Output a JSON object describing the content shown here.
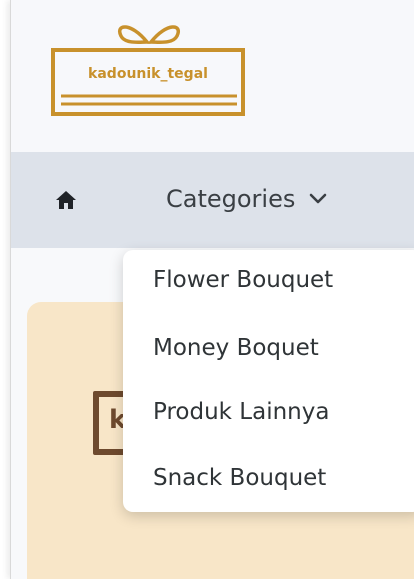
{
  "header": {
    "logo_text": "kadounik_tegal",
    "brand_color": "#c8912c"
  },
  "navbar": {
    "home_icon": "home-icon",
    "categories_label": "Categories",
    "categories_icon": "chevron-down-icon"
  },
  "dropdown": {
    "items": [
      {
        "label": "Flower Bouquet"
      },
      {
        "label": "Money Boquet"
      },
      {
        "label": "Produk Lainnya"
      },
      {
        "label": "Snack Bouquet"
      }
    ]
  },
  "card": {
    "logo_partial_letter": "k",
    "background_color": "#f8e6c8"
  }
}
